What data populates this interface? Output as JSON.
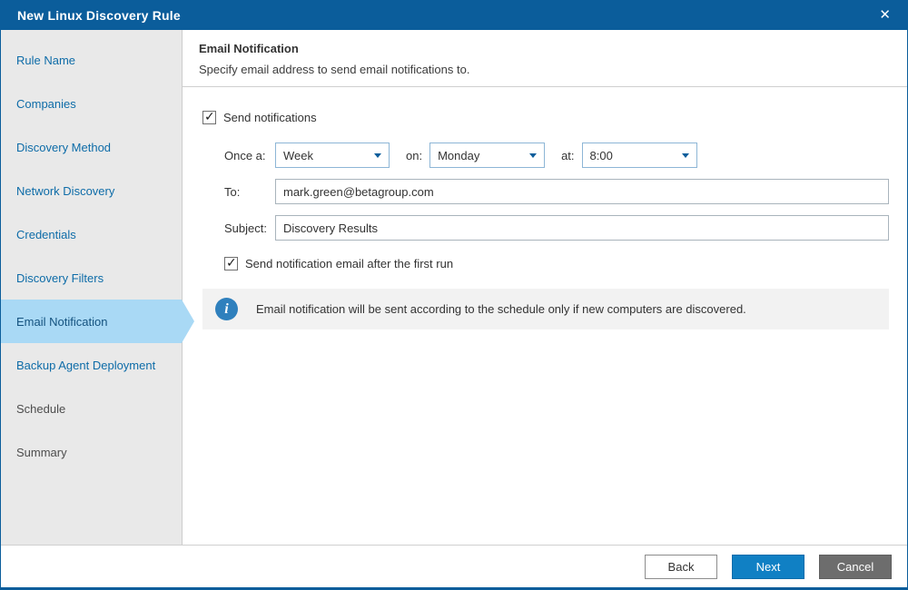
{
  "window": {
    "title": "New Linux Discovery Rule",
    "close_icon": "✕"
  },
  "sidebar": {
    "items": [
      {
        "label": "Rule Name",
        "state": "enabled"
      },
      {
        "label": "Companies",
        "state": "enabled"
      },
      {
        "label": "Discovery Method",
        "state": "enabled"
      },
      {
        "label": "Network Discovery",
        "state": "enabled"
      },
      {
        "label": "Credentials",
        "state": "enabled"
      },
      {
        "label": "Discovery Filters",
        "state": "enabled"
      },
      {
        "label": "Email Notification",
        "state": "current"
      },
      {
        "label": "Backup Agent Deployment",
        "state": "enabled"
      },
      {
        "label": "Schedule",
        "state": "upcoming"
      },
      {
        "label": "Summary",
        "state": "upcoming"
      }
    ]
  },
  "content": {
    "heading": "Email Notification",
    "subheading": "Specify email address to send email notifications to.",
    "send_notifications": {
      "label": "Send notifications",
      "checked": true
    },
    "schedule": {
      "once_a_label": "Once a:",
      "frequency": "Week",
      "on_label": "on:",
      "day": "Monday",
      "at_label": "at:",
      "time": "8:00"
    },
    "to": {
      "label": "To:",
      "value": "mark.green@betagroup.com"
    },
    "subject": {
      "label": "Subject:",
      "value": "Discovery Results"
    },
    "first_run": {
      "label": "Send notification email after the first run",
      "checked": true
    },
    "info": {
      "icon": "i",
      "text": "Email notification will be sent according to the schedule only if new computers are discovered."
    }
  },
  "footer": {
    "back": "Back",
    "next": "Next",
    "cancel": "Cancel"
  },
  "colors": {
    "titlebar": "#0b5d9b",
    "accent": "#1080c4",
    "active_step_bg": "#a9d9f5",
    "info_icon": "#2f80bd",
    "cancel_gray": "#6d6d6d"
  }
}
